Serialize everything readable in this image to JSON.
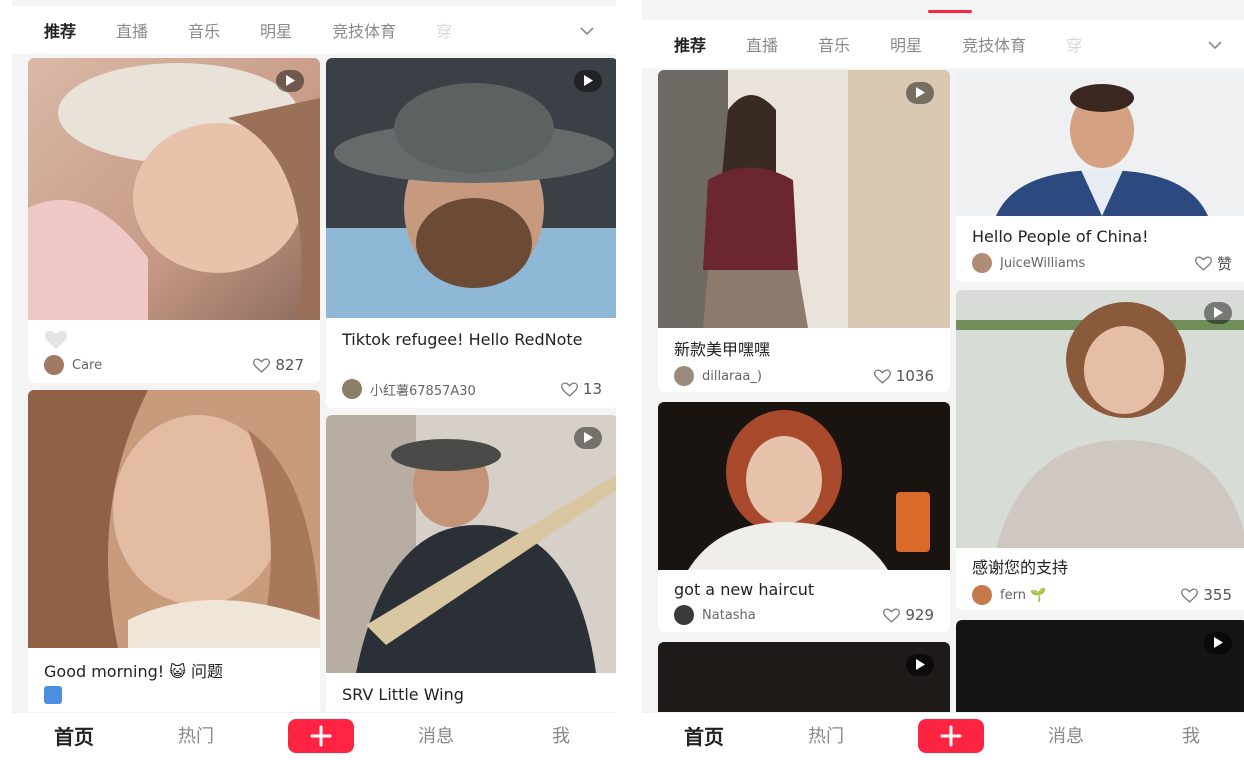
{
  "left": {
    "tabs": [
      "推荐",
      "直播",
      "音乐",
      "明星",
      "竞技体育",
      "穿"
    ],
    "cards": {
      "care": {
        "author": "Care",
        "likes": "827"
      },
      "tiktok": {
        "caption": "Tiktok refugee! Hello RedNote",
        "author": "小红薯67857A30",
        "likes": "13"
      },
      "morning": {
        "caption": "Good morning! 😺 问题"
      },
      "srv": {
        "caption": "SRV Little Wing"
      }
    },
    "nav": {
      "home": "首页",
      "hot": "热门",
      "messages": "消息",
      "me": "我"
    }
  },
  "right": {
    "tabs": [
      "推荐",
      "直播",
      "音乐",
      "明星",
      "竞技体育",
      "穿"
    ],
    "cards": {
      "nail": {
        "caption": "新款美甲嘿嘿",
        "author": "dillaraa_)",
        "likes": "1036"
      },
      "hello": {
        "caption": "Hello People of China!",
        "author": "JuiceWilliams",
        "likes": "赞"
      },
      "haircut": {
        "caption": "got a new haircut",
        "author": "Natasha",
        "likes": "929"
      },
      "thanks": {
        "caption": "感谢您的支持",
        "author": "fern 🌱",
        "likes": "355"
      }
    },
    "nav": {
      "home": "首页",
      "hot": "热门",
      "messages": "消息",
      "me": "我"
    }
  },
  "colors": {
    "accent": "#ff2442",
    "background": "#f4f4f4",
    "card": "#ffffff"
  }
}
